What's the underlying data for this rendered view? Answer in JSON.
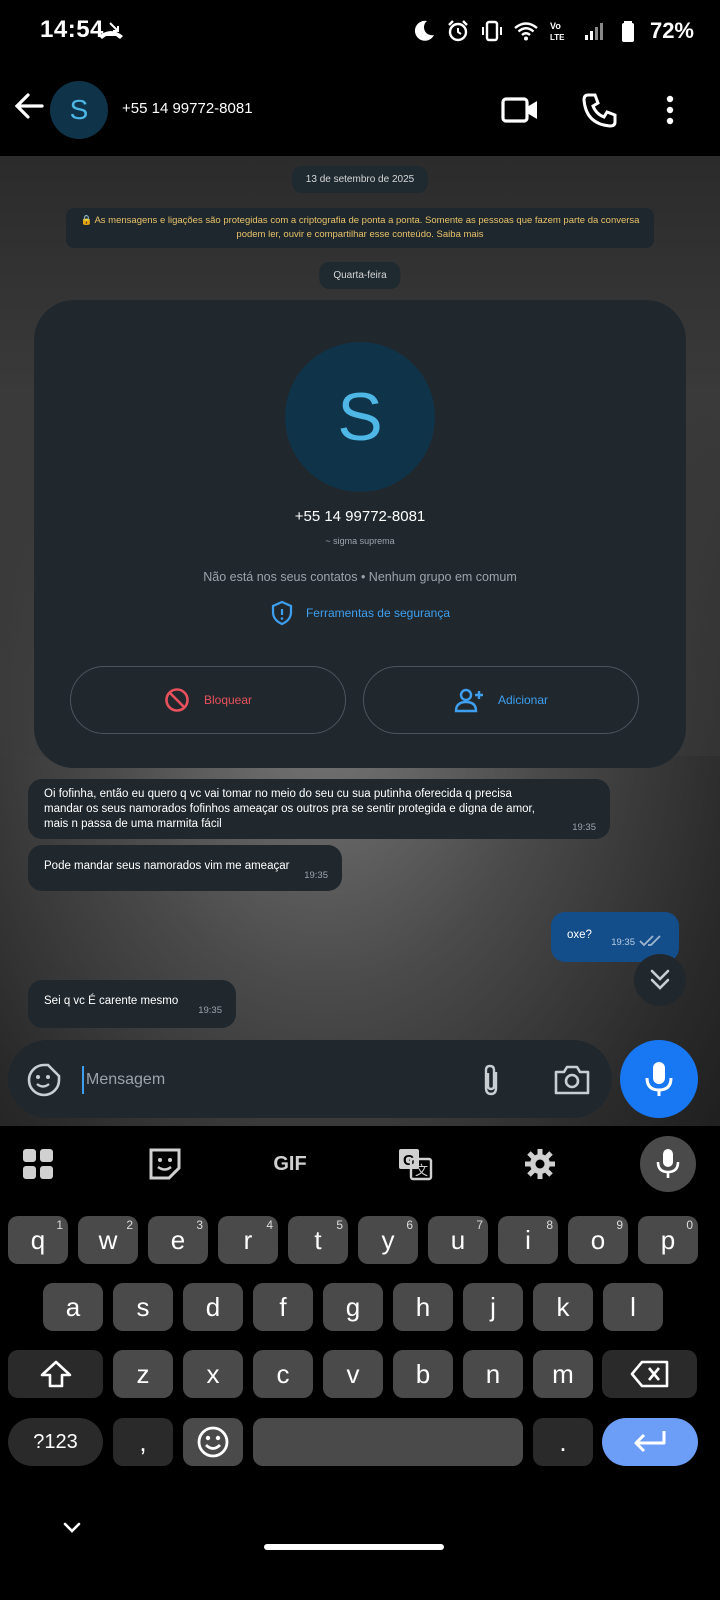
{
  "status_bar": {
    "time": "14:54",
    "battery": "72%"
  },
  "header": {
    "avatar_letter": "S",
    "contact": "+55 14 99772-8081"
  },
  "chat": {
    "date_pill": "13 de setembro de 2025",
    "encryption_notice": "🔒 As mensagens e ligações são protegidas com a criptografia de ponta a ponta. Somente as pessoas que fazem parte da conversa podem ler, ouvir e compartilhar esse conteúdo. Saiba mais",
    "day_pill": "Quarta-feira",
    "card": {
      "avatar_letter": "S",
      "phone": "+55 14 99772-8081",
      "alias": "~ sigma suprema",
      "info": "Não está nos seus contatos • Nenhum grupo em comum",
      "security": "Ferramentas de segurança",
      "block": "Bloquear",
      "add": "Adicionar"
    },
    "messages": [
      {
        "text": "Oi fofinha, então eu quero q vc vai tomar no meio do seu cu sua putinha oferecida q precisa mandar os seus namorados fofinhos ameaçar os outros pra se sentir protegida e digna de amor, mais n passa de uma marmita fácil",
        "time": "19:35"
      },
      {
        "text": "Pode mandar seus namorados vim me ameaçar",
        "time": "19:35"
      },
      {
        "text": "oxe?",
        "time": "19:35"
      },
      {
        "text": "Sei q vc É carente mesmo",
        "time": "19:35"
      }
    ]
  },
  "composer": {
    "placeholder": "Mensagem"
  },
  "keyboard": {
    "toolbar": [
      "apps-icon",
      "sticker-icon",
      "GIF",
      "translate-icon",
      "settings-icon",
      "mic-icon"
    ],
    "row1": [
      [
        "q",
        "1"
      ],
      [
        "w",
        "2"
      ],
      [
        "e",
        "3"
      ],
      [
        "r",
        "4"
      ],
      [
        "t",
        "5"
      ],
      [
        "y",
        "6"
      ],
      [
        "u",
        "7"
      ],
      [
        "i",
        "8"
      ],
      [
        "o",
        "9"
      ],
      [
        "p",
        "0"
      ]
    ],
    "row2": [
      "a",
      "s",
      "d",
      "f",
      "g",
      "h",
      "j",
      "k",
      "l"
    ],
    "row3": [
      "z",
      "x",
      "c",
      "v",
      "b",
      "n",
      "m"
    ],
    "symbols": "?123",
    "comma": ",",
    "period": "."
  },
  "colors": {
    "accent": "#1877f2",
    "bubble": "#20282e",
    "bubble_out": "#134d8a",
    "block_red": "#e8505b",
    "link_blue": "#3e9ff0"
  }
}
